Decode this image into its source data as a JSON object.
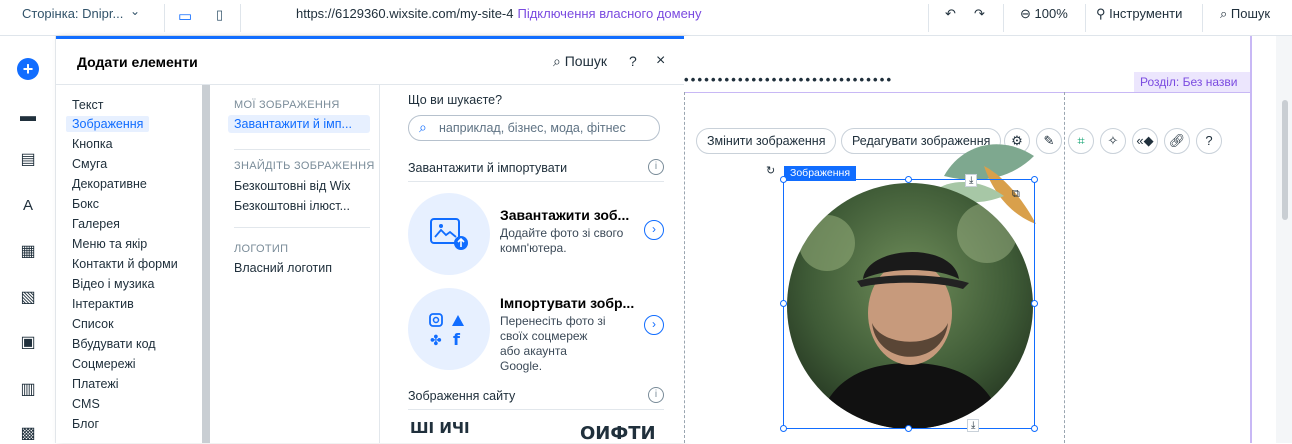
{
  "topbar": {
    "page_label": "Сторінка: Dnipr...",
    "url": "https://6129360.wixsite.com/my-site-4",
    "connect_domain": "Підключення власного домену",
    "zoom": "100%",
    "tools": "Інструменти",
    "search": "Пошук"
  },
  "panel": {
    "title": "Додати елементи",
    "search": "Пошук",
    "help": "?",
    "close": "×",
    "categories": [
      "Текст",
      "Зображення",
      "Кнопка",
      "Смуга",
      "Декоративне",
      "Бокс",
      "Галерея",
      "Меню та якір",
      "Контакти й форми",
      "Відео і музика",
      "Інтерактив",
      "Список",
      "Вбудувати код",
      "Соцмережі",
      "Платежі",
      "CMS",
      "Блог"
    ],
    "sub": {
      "my_images_header": "МОЇ ЗОБРАЖЕННЯ",
      "upload_import": "Завантажити й імп...",
      "find_header": "ЗНАЙДІТЬ ЗОБРАЖЕННЯ",
      "free_wix": "Безкоштовні від Wix",
      "free_illus": "Безкоштовні ілюст...",
      "logo_header": "ЛОГОТИП",
      "own_logo": "Власний логотип"
    },
    "content": {
      "what_label": "Що ви шукаєте?",
      "search_placeholder": "наприклад, бізнес, мода, фітнес",
      "upload_section": "Завантажити й імпортувати",
      "upload_title": "Завантажити зоб...",
      "upload_desc": "Додайте фото зі свого комп'ютера.",
      "import_title": "Імпортувати зобр...",
      "import_desc": "Перенесіть фото зі своїх соцмереж або акаунта Google.",
      "site_images": "Зображення сайту",
      "preview_left": "ШІ ИЧІ",
      "preview_right": "ОИФТИ"
    }
  },
  "canvas": {
    "section_tag": "Розділ: Без назви",
    "change_image": "Змінити зображення",
    "edit_image": "Редагувати зображення",
    "image_tag": "Зображення"
  },
  "colors": {
    "accent": "#116dff",
    "section": "#7a4ae0"
  }
}
